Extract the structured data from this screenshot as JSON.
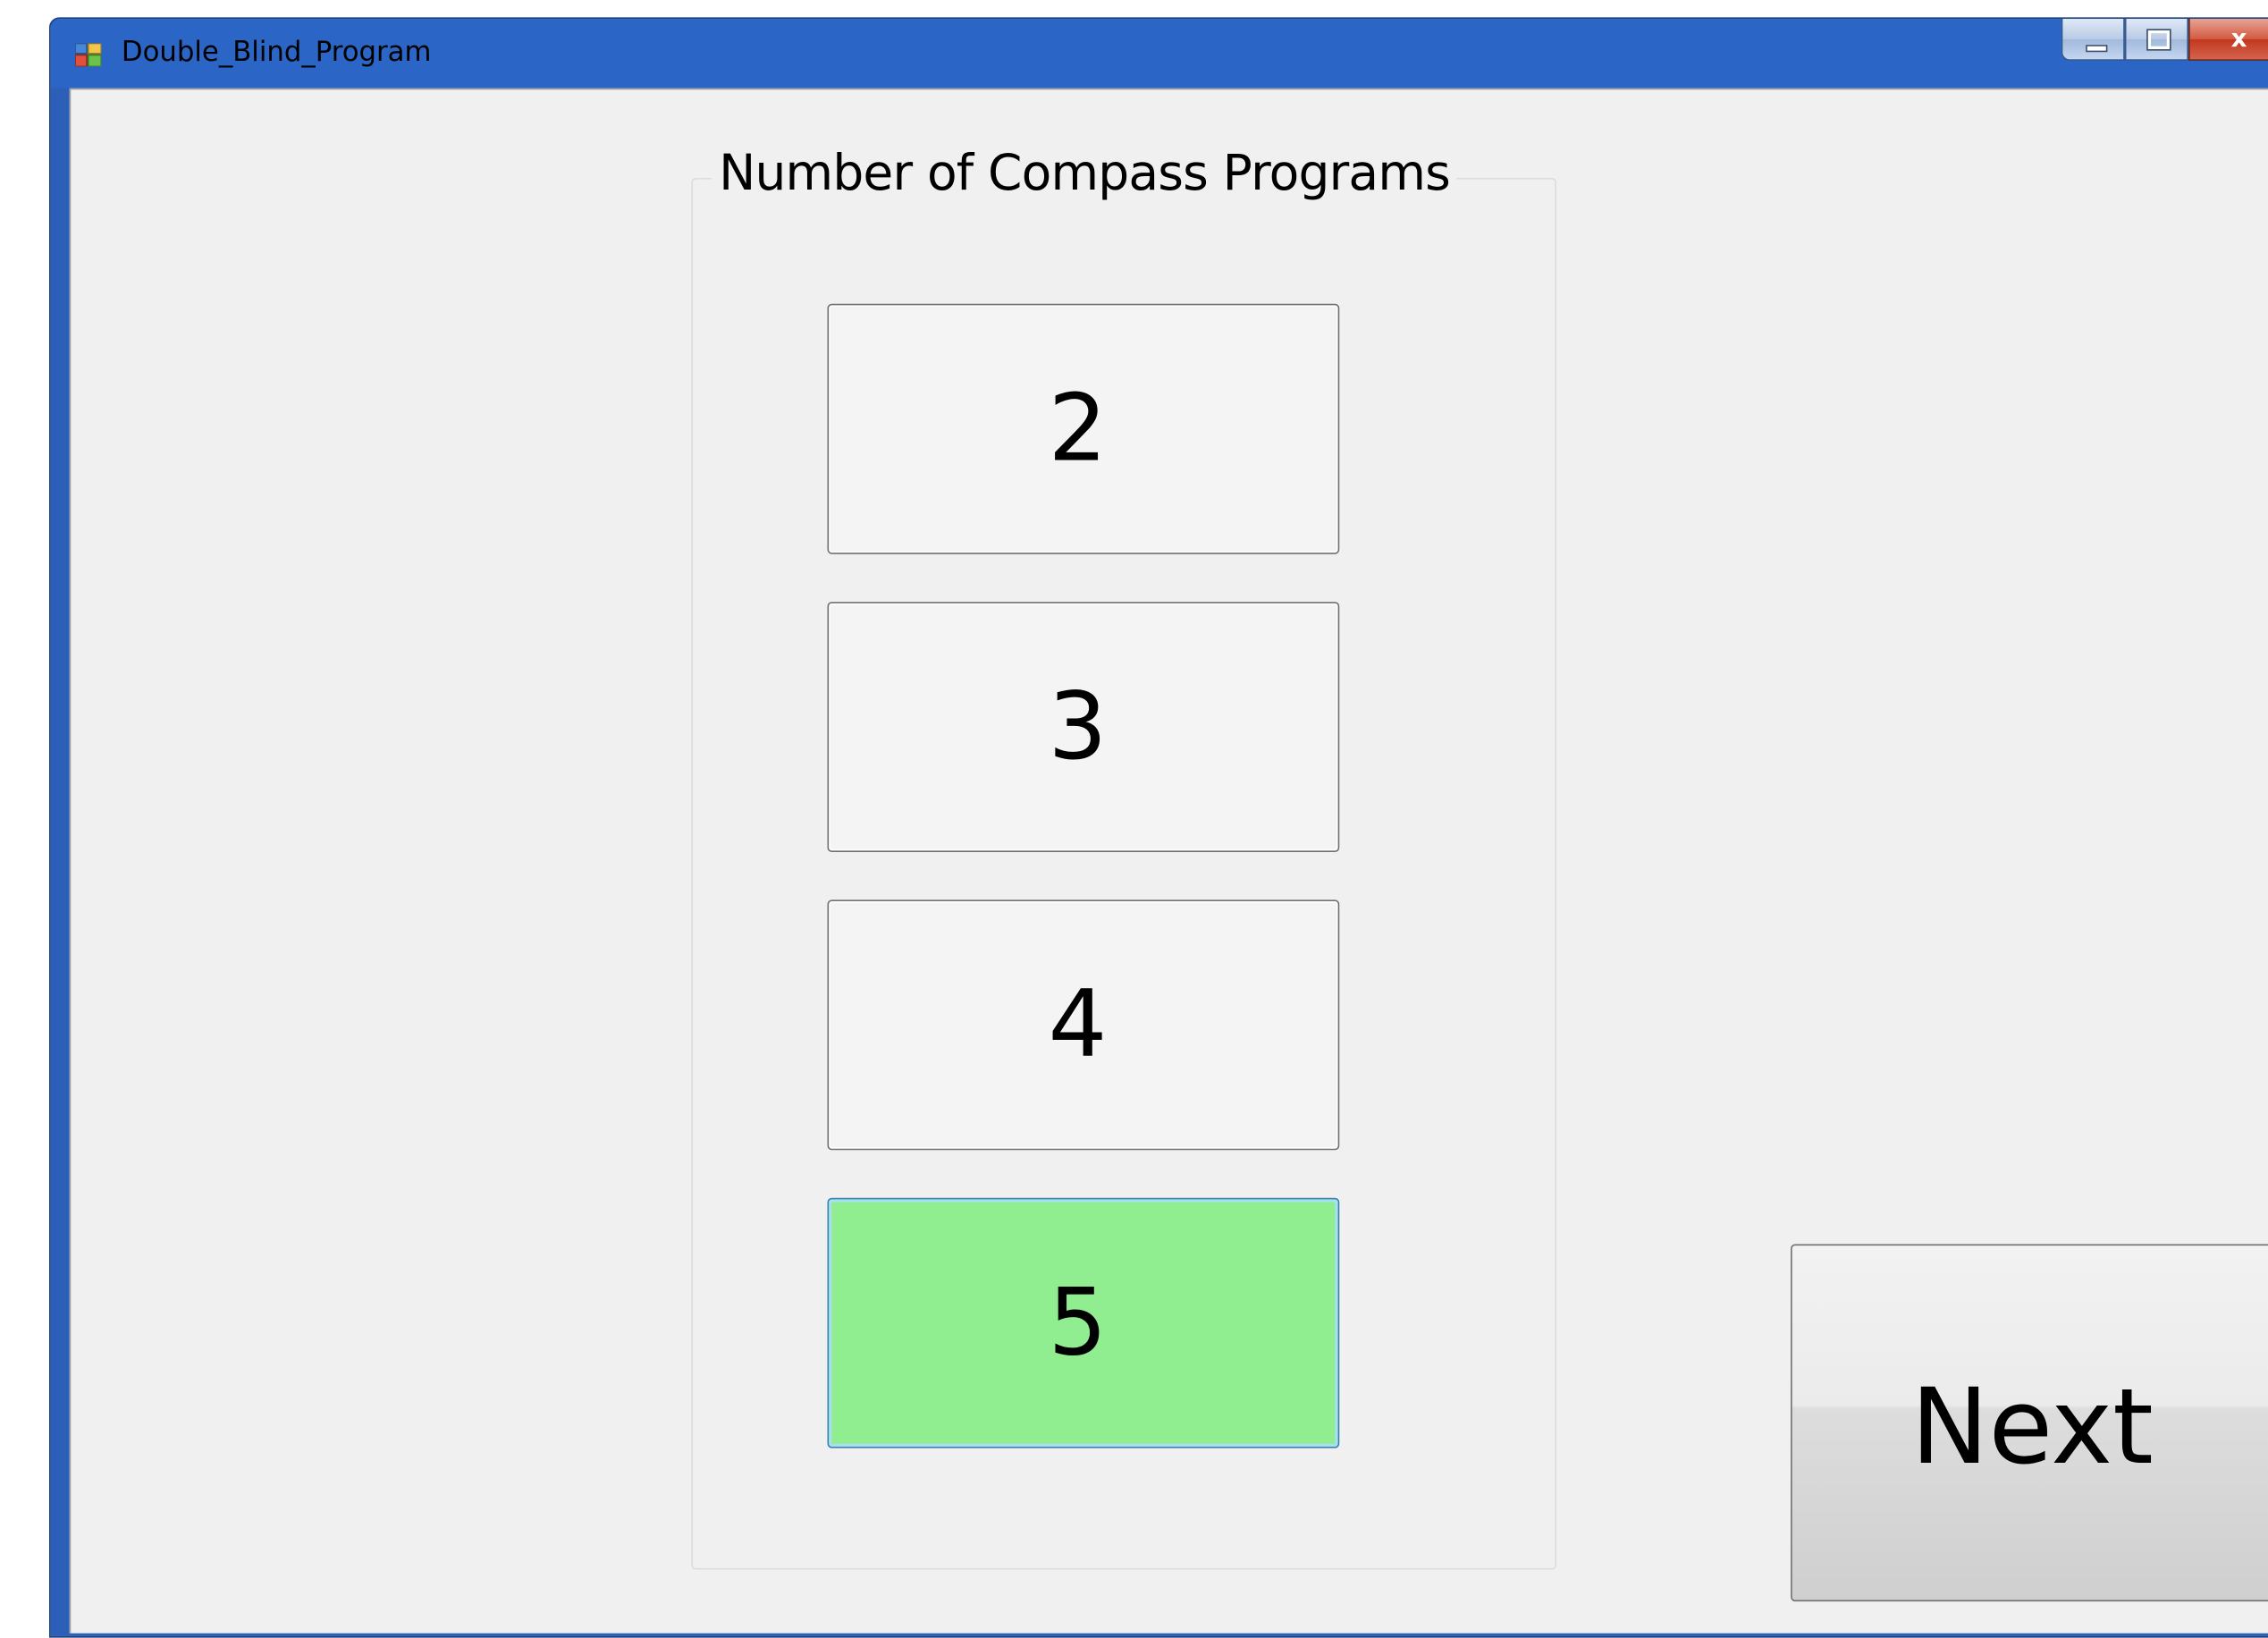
{
  "window": {
    "title": "Double_Blind_Program",
    "controls": {
      "close_glyph": "x"
    }
  },
  "group": {
    "label": "Number of Compass Programs",
    "options": [
      {
        "label": "2",
        "selected": false
      },
      {
        "label": "3",
        "selected": false
      },
      {
        "label": "4",
        "selected": false
      },
      {
        "label": "5",
        "selected": true
      }
    ],
    "selected_color": "#90ee90"
  },
  "next_button": {
    "label": "Next"
  },
  "icons": {
    "app": "app-window-icon",
    "minimize": "minimize-icon",
    "maximize": "maximize-icon",
    "close": "close-icon"
  }
}
